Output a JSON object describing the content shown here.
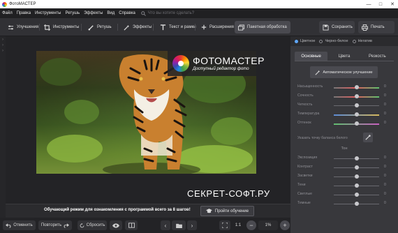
{
  "window": {
    "title": "ФотоМАСТЕР"
  },
  "menu": {
    "items": [
      "Файл",
      "Правка",
      "Инструменты",
      "Ретушь",
      "Эффекты",
      "Вид",
      "Справка"
    ],
    "search_placeholder": "Что вы хотите сделать?"
  },
  "toolbar": {
    "tabs": [
      "Улучшения",
      "Инструменты",
      "Ретушь",
      "Эффекты",
      "Текст и рамки",
      "Расширения",
      "Пакетная обработка"
    ],
    "save_label": "Сохранить",
    "print_label": "Печать"
  },
  "badge": {
    "brand": "ФОТОМАСТЕР",
    "slogan": "Доступный редактор фото"
  },
  "watermark": "СЕКРЕТ-СОФТ.РУ",
  "training": {
    "message": "Обучающий режим для ознакомления с программой всего за 8 шагов!",
    "button_label": "Пройти обучение"
  },
  "bottom": {
    "undo_label": "Отменить",
    "redo_label": "Повторить",
    "reset_label": "Сбросить",
    "ratio_label": "1:1",
    "zoom_value": "1%"
  },
  "panel": {
    "modes": [
      "Цветное",
      "Черно-белое",
      "Негатив"
    ],
    "tabs": [
      "Основные",
      "Цвета",
      "Резкость"
    ],
    "auto_label": "Автоматическое улучшение",
    "sliders_top": [
      {
        "label": "Насыщенность",
        "value": "0"
      },
      {
        "label": "Сочность",
        "value": "0"
      },
      {
        "label": "Четкость",
        "value": "0"
      },
      {
        "label": "Температура",
        "value": "0"
      },
      {
        "label": "Оттенок",
        "value": "0"
      }
    ],
    "wb_label": "Указать точку баланса белого",
    "section_tone": "Тон",
    "sliders_tone": [
      {
        "label": "Экспозиция",
        "value": "0"
      },
      {
        "label": "Контраст",
        "value": "0"
      },
      {
        "label": "Засветки",
        "value": "0"
      },
      {
        "label": "Тени",
        "value": "0"
      },
      {
        "label": "Светлые",
        "value": "0"
      },
      {
        "label": "Темные",
        "value": "0"
      }
    ]
  }
}
